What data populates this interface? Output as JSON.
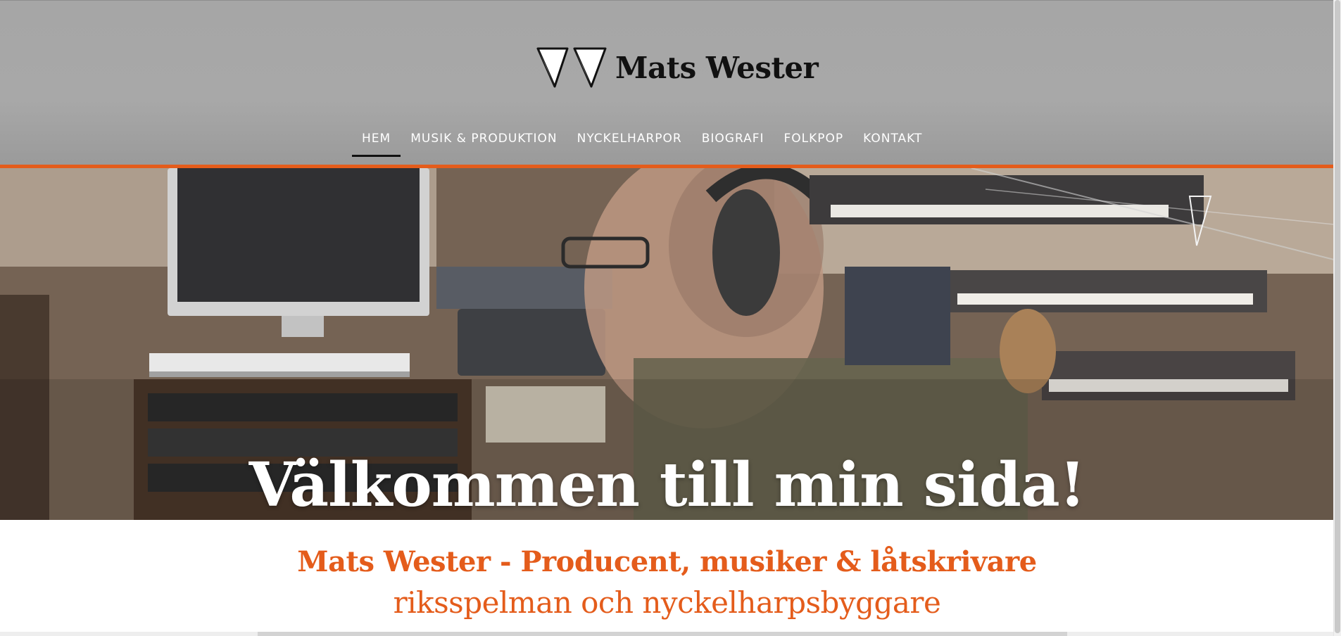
{
  "site": {
    "brand_name": "Mats Wester",
    "logo_icon": "double-v-logo-icon"
  },
  "nav": {
    "items": [
      {
        "label": "HEM",
        "active": true
      },
      {
        "label": "MUSIK & PRODUKTION",
        "active": false
      },
      {
        "label": "NYCKELHARPOR",
        "active": false
      },
      {
        "label": "BIOGRAFI",
        "active": false
      },
      {
        "label": "FOLKPOP",
        "active": false
      },
      {
        "label": "KONTAKT",
        "active": false
      }
    ]
  },
  "hero": {
    "title": "Välkommen till min sida!"
  },
  "intro": {
    "heading": "Mats Wester - Producent, musiker & låtskrivare",
    "subheading": "riksspelman och nyckelharpsbyggare"
  },
  "colors": {
    "accent": "#e45c1b",
    "header_bg": "#a6a6a6",
    "nav_text": "#ffffff",
    "brand_text": "#111111"
  }
}
